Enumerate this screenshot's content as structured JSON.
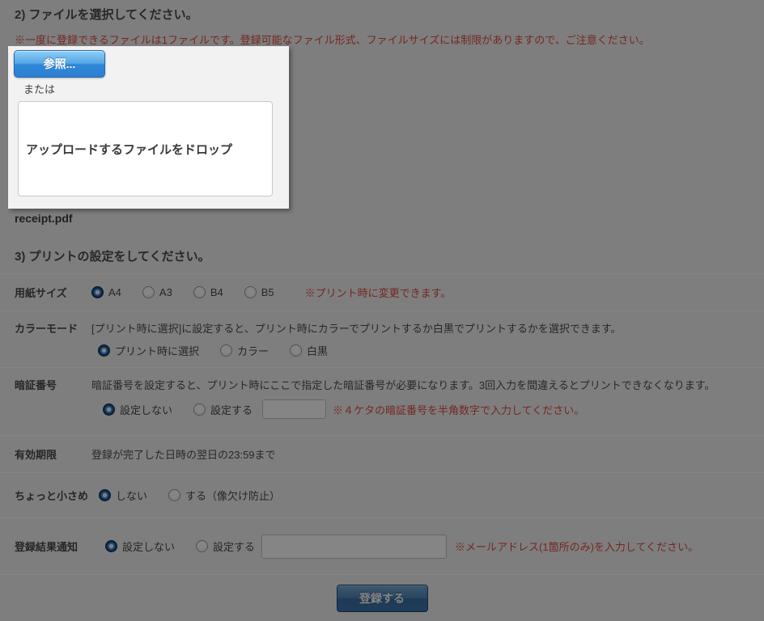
{
  "file_section": {
    "heading": "2) ファイルを選択してください。",
    "warning": "※一度に登録できるファイルは1ファイルです。登録可能なファイル形式、ファイルサイズには制限がありますので、ご注意ください。",
    "browse_button_label": "参照...",
    "or_label": "または",
    "dropzone_text": "アップロードするファイルをドロップ",
    "selected_file_name": "receipt.pdf"
  },
  "print_section": {
    "heading": "3) プリントの設定をしてください。",
    "paper_size": {
      "label": "用紙サイズ",
      "options": [
        "A4",
        "A3",
        "B4",
        "B5"
      ],
      "selected": "A4",
      "note": "※プリント時に変更できます。"
    },
    "color_mode": {
      "label": "カラーモード",
      "description": "[プリント時に選択]に設定すると、プリント時にカラーでプリントするか白黒でプリントするかを選択できます。",
      "options": [
        "プリント時に選択",
        "カラー",
        "白黒"
      ],
      "selected": "プリント時に選択"
    },
    "pin_code": {
      "label": "暗証番号",
      "description": "暗証番号を設定すると、プリント時にここで指定した暗証番号が必要になります。3回入力を間違えるとプリントできなくなります。",
      "options": [
        "設定しない",
        "設定する"
      ],
      "selected": "設定しない",
      "input_value": "",
      "note": "※４ケタの暗証番号を半角数字で入力してください。"
    },
    "expiry": {
      "label": "有効期限",
      "value": "登録が完了した日時の翌日の23:59まで"
    },
    "slightly_smaller": {
      "label": "ちょっと小さめ",
      "options": [
        "しない",
        "する（像欠け防止）"
      ],
      "selected": "しない"
    },
    "result_notification": {
      "label": "登録結果通知",
      "options": [
        "設定しない",
        "設定する"
      ],
      "selected": "設定しない",
      "input_value": "",
      "note": "※メールアドレス(1箇所のみ)を入力してください。"
    }
  },
  "submit_button_label": "登録する",
  "colors": {
    "browse_button_blue": "#2f86d6",
    "submit_button_blue": "#3f74ab",
    "note_red": "#e14b41",
    "overlay": "rgba(0,0,0,0.48)"
  }
}
